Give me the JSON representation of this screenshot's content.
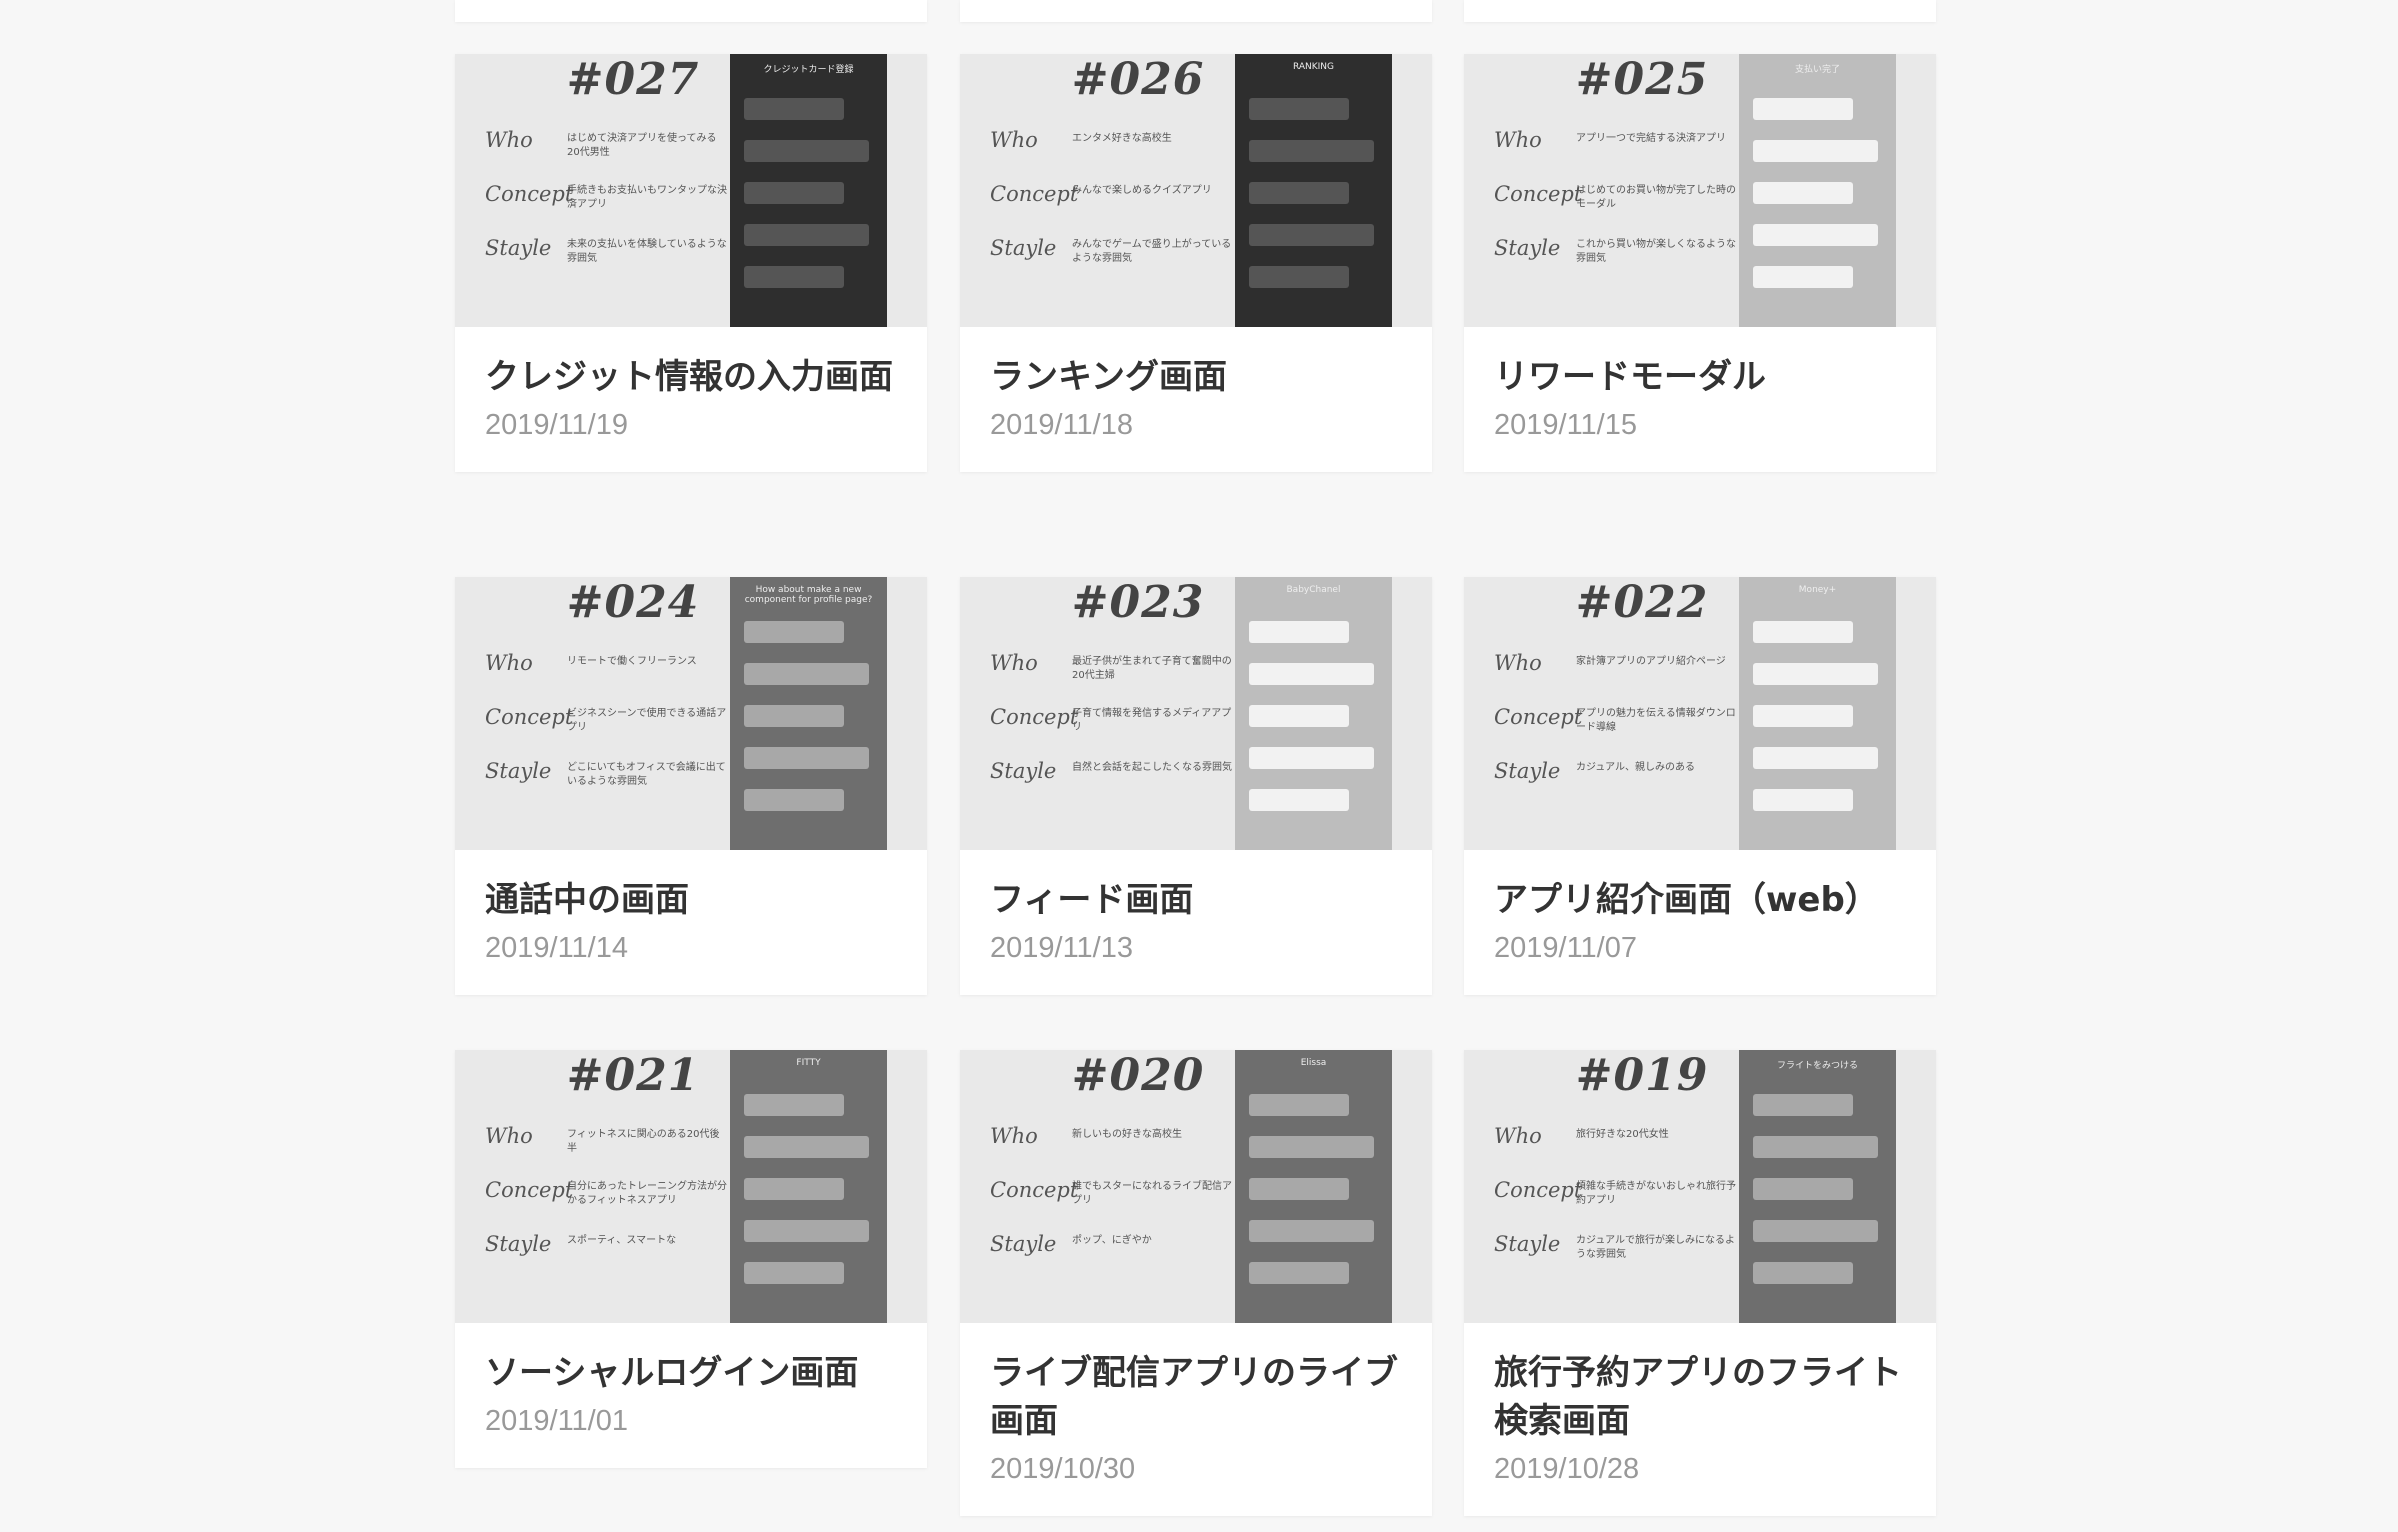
{
  "row_labels": {
    "who": "Who",
    "concept": "Concept",
    "style": "Stayle"
  },
  "cards": [
    {
      "num": "#027",
      "who": "はじめて決済アプリを使ってみる20代男性",
      "concept": "手続きもお支払いもワンタップな決済アプリ",
      "style": "未来の支払いを体験しているような雰囲気",
      "phone_label": "クレジットカード登録",
      "title": "クレジット情報の入力画面",
      "date": "2019/11/19"
    },
    {
      "num": "#026",
      "who": "エンタメ好きな高校生",
      "concept": "みんなで楽しめるクイズアプリ",
      "style": "みんなでゲームで盛り上がっているような雰囲気",
      "phone_label": "RANKING",
      "title": "ランキング画面",
      "date": "2019/11/18"
    },
    {
      "num": "#025",
      "who": "アプリ一つで完結する決済アプリ",
      "concept": "はじめてのお買い物が完了した時のモーダル",
      "style": "これから買い物が楽しくなるような雰囲気",
      "phone_label": "支払い完了",
      "title": "リワードモーダル",
      "date": "2019/11/15"
    },
    {
      "num": "#024",
      "who": "リモートで働くフリーランス",
      "concept": "ビジネスシーンで使用できる通話アプリ",
      "style": "どこにいてもオフィスで会議に出ているような雰囲気",
      "phone_label": "How about make a new component for profile page?",
      "title": "通話中の画面",
      "date": "2019/11/14"
    },
    {
      "num": "#023",
      "who": "最近子供が生まれて子育て奮闘中の20代主婦",
      "concept": "子育て情報を発信するメディアアプリ",
      "style": "自然と会話を起こしたくなる雰囲気",
      "phone_label": "BabyChanel",
      "title": "フィード画面",
      "date": "2019/11/13"
    },
    {
      "num": "#022",
      "who": "家計簿アプリのアプリ紹介ページ",
      "concept": "アプリの魅力を伝える情報ダウンロード導線",
      "style": "カジュアル、親しみのある",
      "phone_label": "Money+",
      "title": "アプリ紹介画面（web）",
      "date": "2019/11/07"
    },
    {
      "num": "#021",
      "who": "フィットネスに関心のある20代後半",
      "concept": "自分にあったトレーニング方法が分かるフィットネスアプリ",
      "style": "スポーティ、スマートな",
      "phone_label": "FITTY",
      "title": "ソーシャルログイン画面",
      "date": "2019/11/01"
    },
    {
      "num": "#020",
      "who": "新しいもの好きな高校生",
      "concept": "誰でもスターになれるライブ配信アプリ",
      "style": "ポップ、にぎやか",
      "phone_label": "Elissa",
      "title": "ライブ配信アプリのライブ画面",
      "date": "2019/10/30"
    },
    {
      "num": "#019",
      "who": "旅行好きな20代女性",
      "concept": "煩雑な手続きがないおしゃれ旅行予約アプリ",
      "style": "カジュアルで旅行が楽しみになるような雰囲気",
      "phone_label": "フライトをみつける",
      "title": "旅行予約アプリのフライト検索画面",
      "date": "2019/10/28"
    }
  ]
}
